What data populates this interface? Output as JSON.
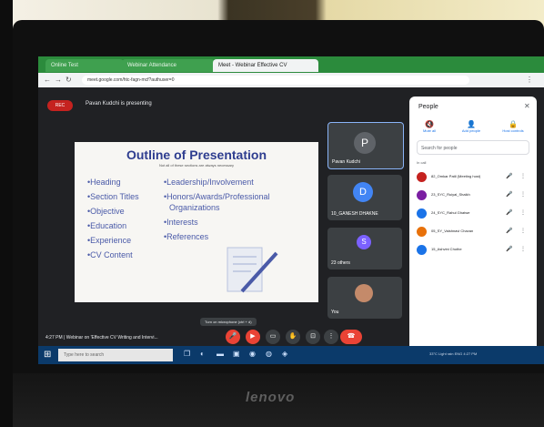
{
  "browser": {
    "tabs": [
      {
        "label": "Online Test"
      },
      {
        "label": "Webinar Attendance"
      },
      {
        "label": "Meet - Webinar Effective CV"
      }
    ],
    "url": "meet.google.com/htc-fagn-mcf?authuser=0"
  },
  "meet": {
    "rec_label": "REC",
    "presenting_text": "Pavan Kudchi is presenting",
    "slide": {
      "title": "Outline of Presentation",
      "subtitle": "Not all of these sections are always necessary",
      "left_items": [
        "Heading",
        "Section Titles",
        "Objective",
        "Education",
        "Experience",
        "CV Content"
      ],
      "right_items": [
        "Leadership/Involvement",
        "Honors/Awards/Professional",
        "Organizations",
        "Interests",
        "References"
      ]
    },
    "tiles": [
      {
        "initial": "P",
        "name": "Pavan Kudchi",
        "color": "#5f6368"
      },
      {
        "initial": "D",
        "name": "10_GANESH DHAKNE",
        "color": "#4285f4"
      },
      {
        "initial": "S",
        "name": "23 others",
        "color": "#7b61ff"
      },
      {
        "initial": "",
        "name": "You",
        "color": "#c48a6a"
      }
    ],
    "tooltip": "Turn on microphone (ctrl + d)",
    "time_title": "4:27 PM | Webinar on 'Effective CV Writing and Intervi...",
    "controls": [
      "mic-off",
      "cam-off",
      "captions",
      "raise-hand",
      "present",
      "more"
    ]
  },
  "people": {
    "title": "People",
    "actions": [
      {
        "label": "Mute all",
        "glyph": "🔇"
      },
      {
        "label": "Add people",
        "glyph": "👤"
      },
      {
        "label": "Host controls",
        "glyph": "🔒"
      }
    ],
    "search_placeholder": "Search for people",
    "in_call": "In call",
    "participants": [
      {
        "name": "82_Omkar Patil (Meeting host)",
        "color": "#c5221f"
      },
      {
        "name": "23_SYC_Ruiyal_Shaikh",
        "color": "#7b1fa2"
      },
      {
        "name": "24_SYC_Rahul Ghatwe",
        "color": "#1a73e8"
      },
      {
        "name": "05_SY_Vaishnavi Chavan",
        "color": "#e8710a"
      },
      {
        "name": "15_Ashvini Chothe",
        "color": "#1a73e8"
      }
    ]
  },
  "taskbar": {
    "search_placeholder": "Type here to search",
    "tray": "33°C  Light rain  ENG  4:27 PM"
  },
  "laptop": {
    "brand": "lenovo"
  }
}
